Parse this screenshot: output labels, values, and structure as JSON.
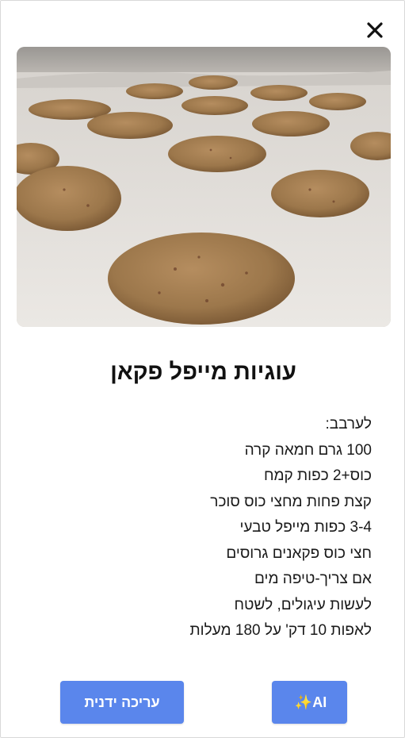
{
  "dialog": {
    "close_symbol": "✕",
    "close_icon": "close-icon"
  },
  "photo": {
    "alt": "Cookies on a baking sheet",
    "icon": "photo"
  },
  "recipe": {
    "title": "עוגיות מייפל פקאן",
    "lines": [
      "לערבב:",
      "100 גרם חמאה קרה",
      "כוס+2 כפות קמח",
      "קצת פחות מחצי כוס סוכר",
      "3-4 כפות מייפל טבעי",
      "חצי כוס פקאנים גרוסים",
      "אם צריך-טיפה מים",
      "לעשות עיגולים, לשטח",
      "לאפות 10 דק' על 180 מעלות"
    ]
  },
  "actions": {
    "ai_label": "AI",
    "ai_sparkle": "✨",
    "manual_edit_label": "עריכה ידנית",
    "button_color": "#5a86ec"
  }
}
